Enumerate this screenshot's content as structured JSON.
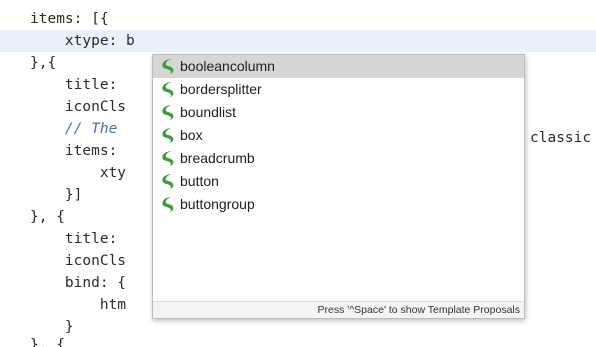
{
  "editor": {
    "lines": [
      {
        "text": "items: [{"
      },
      {
        "text": "    xtype: b"
      },
      {
        "text": "},{"
      },
      {
        "text": "    title:"
      },
      {
        "text": "    iconCls"
      },
      {
        "text": "    // The"
      },
      {
        "text": "    items:"
      },
      {
        "text": "        xty"
      },
      {
        "text": "    }]"
      },
      {
        "text": "}, {"
      },
      {
        "text": "    title:"
      },
      {
        "text": "    iconCls"
      },
      {
        "text": "    bind: {"
      },
      {
        "text": "        htm"
      },
      {
        "text": "    }"
      },
      {
        "text": "}, {"
      }
    ],
    "overflow_text": "classic"
  },
  "autocomplete": {
    "proposals": [
      {
        "label": "booleancolumn",
        "icon": "green-leaf-icon"
      },
      {
        "label": "bordersplitter",
        "icon": "green-leaf-icon"
      },
      {
        "label": "boundlist",
        "icon": "green-leaf-icon"
      },
      {
        "label": "box",
        "icon": "green-leaf-icon"
      },
      {
        "label": "breadcrumb",
        "icon": "green-leaf-icon"
      },
      {
        "label": "button",
        "icon": "green-leaf-icon"
      },
      {
        "label": "buttongroup",
        "icon": "green-leaf-icon"
      }
    ],
    "status_text": "Press '^Space' to show Template Proposals"
  },
  "colors": {
    "current_line": "#e8f0fb",
    "selection": "#d6d6d6",
    "icon_green": "#3f9e3a",
    "comment": "#4a6fb0"
  }
}
